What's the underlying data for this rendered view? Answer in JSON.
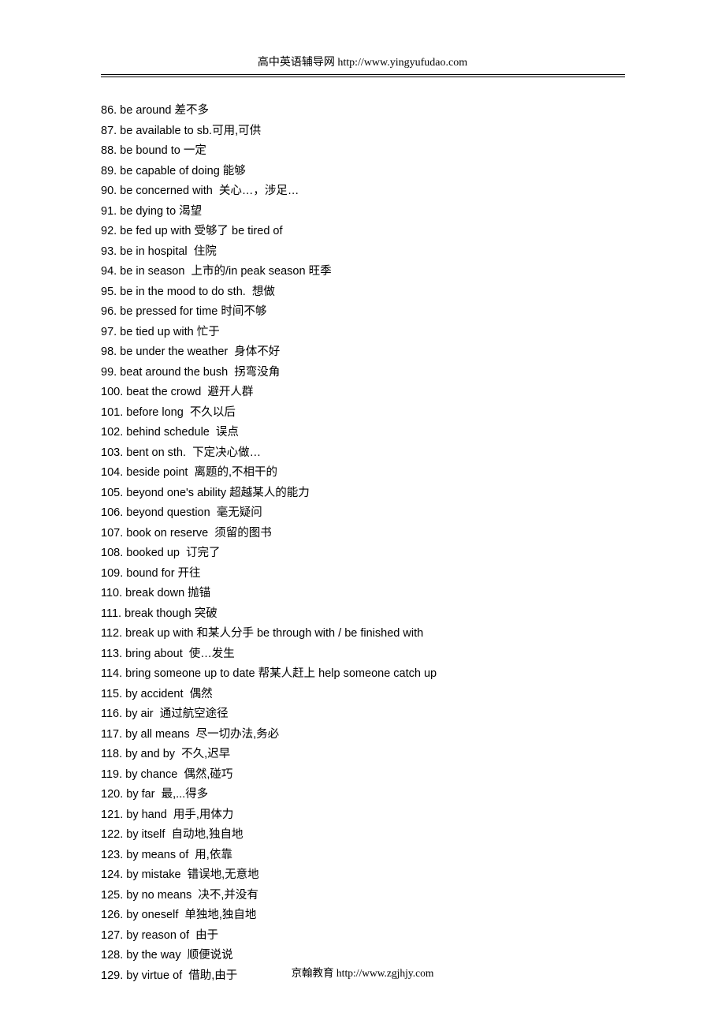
{
  "header": {
    "text": "高中英语辅导网 http://www.yingyufudao.com"
  },
  "items": [
    "86. be around 差不多",
    "87. be available to sb.可用,可供",
    "88. be bound to 一定",
    "89. be capable of doing 能够",
    "90. be concerned with  关心…，涉足…",
    "91. be dying to 渴望",
    "92. be fed up with 受够了 be tired of",
    "93. be in hospital  住院",
    "94. be in season  上市的/in peak season 旺季",
    "95. be in the mood to do sth.  想做",
    "96. be pressed for time 时间不够",
    "97. be tied up with 忙于",
    "98. be under the weather  身体不好",
    "99. beat around the bush  拐弯没角",
    "100. beat the crowd  避开人群",
    "101. before long  不久以后",
    "102. behind schedule  误点",
    "103. bent on sth.  下定决心做…",
    "104. beside point  离题的,不相干的",
    "105. beyond one's ability 超越某人的能力",
    "106. beyond question  毫无疑问",
    "107. book on reserve  须留的图书",
    "108. booked up  订完了",
    "109. bound for 开往",
    "110. break down 抛锚",
    "111. break though 突破",
    "112. break up with 和某人分手 be through with / be finished with",
    "113. bring about  使…发生",
    "114. bring someone up to date 帮某人赶上 help someone catch up",
    "115. by accident  偶然",
    "116. by air  通过航空途径",
    "117. by all means  尽一切办法,务必",
    "118. by and by  不久,迟早",
    "119. by chance  偶然,碰巧",
    "120. by far  最,...得多",
    "121. by hand  用手,用体力",
    "122. by itself  自动地,独自地",
    "123. by means of  用,依靠",
    "124. by mistake  错误地,无意地",
    "125. by no means  决不,并没有",
    "126. by oneself  单独地,独自地",
    "127. by reason of  由于",
    "128. by the way  顺便说说",
    "129. by virtue of  借助,由于"
  ],
  "footer": {
    "text": "京翰教育 http://www.zgjhjy.com"
  }
}
